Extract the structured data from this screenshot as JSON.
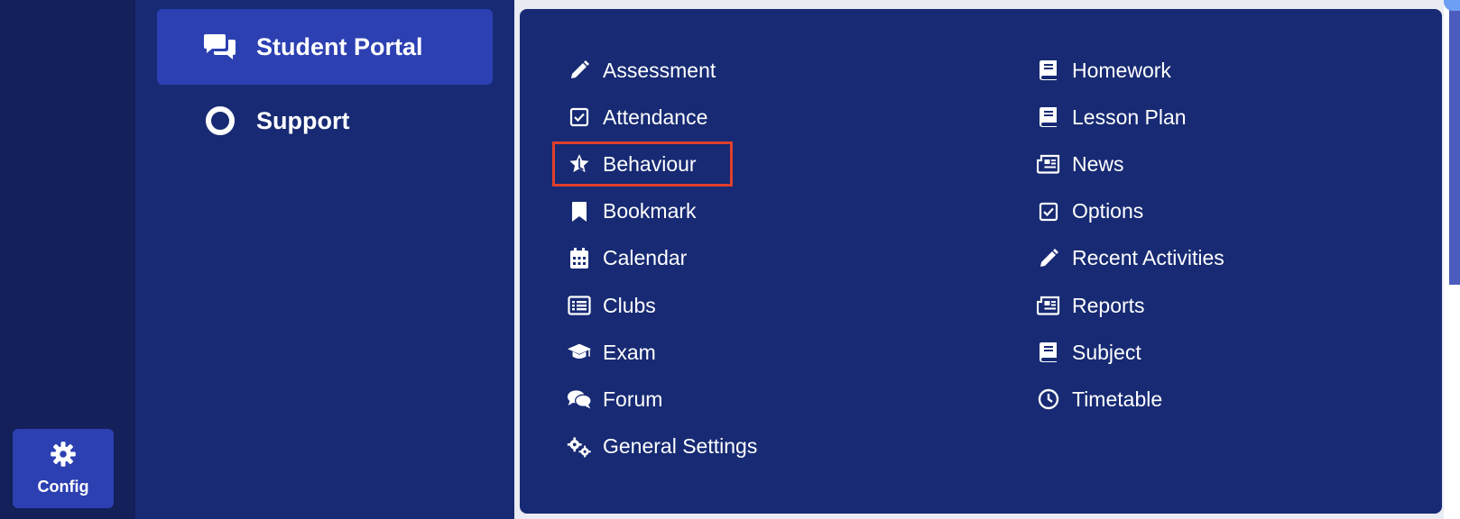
{
  "rail": {
    "config": {
      "label": "Config",
      "icon": "gear-icon"
    }
  },
  "sidebar": {
    "items": [
      {
        "label": "Student Portal",
        "icon": "chat-icon",
        "active": true
      },
      {
        "label": "Support",
        "icon": "circle-icon",
        "active": false
      }
    ]
  },
  "menu": {
    "left": [
      {
        "label": "Assessment",
        "icon": "pencil-icon"
      },
      {
        "label": "Attendance",
        "icon": "checkbox-icon"
      },
      {
        "label": "Behaviour",
        "icon": "star-icon",
        "highlighted": true
      },
      {
        "label": "Bookmark",
        "icon": "bookmark-icon"
      },
      {
        "label": "Calendar",
        "icon": "calendar-icon"
      },
      {
        "label": "Clubs",
        "icon": "list-icon"
      },
      {
        "label": "Exam",
        "icon": "graduation-cap-icon"
      },
      {
        "label": "Forum",
        "icon": "comments-icon"
      },
      {
        "label": "General Settings",
        "icon": "cogs-icon"
      }
    ],
    "right": [
      {
        "label": "Homework",
        "icon": "book-icon"
      },
      {
        "label": "Lesson Plan",
        "icon": "book-icon"
      },
      {
        "label": "News",
        "icon": "newspaper-icon"
      },
      {
        "label": "Options",
        "icon": "checkbox-icon"
      },
      {
        "label": "Recent Activities",
        "icon": "pencil-icon"
      },
      {
        "label": "Reports",
        "icon": "newspaper-icon"
      },
      {
        "label": "Subject",
        "icon": "book-icon"
      },
      {
        "label": "Timetable",
        "icon": "clock-icon"
      }
    ]
  },
  "colors": {
    "rail_bg": "#13205a",
    "sidebar_bg": "#172a73",
    "accent": "#2c40b2",
    "highlight_border": "#e0402c"
  }
}
